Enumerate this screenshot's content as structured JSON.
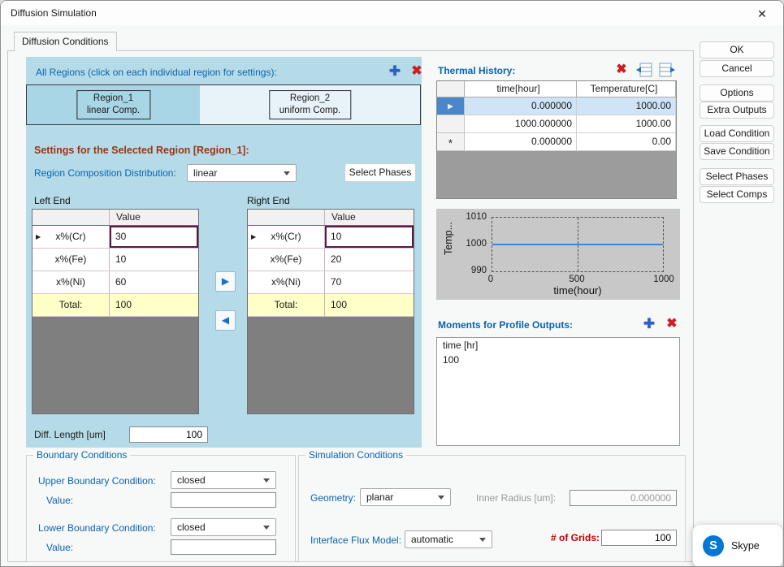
{
  "window": {
    "title": "Diffusion Simulation"
  },
  "tab": {
    "label": "Diffusion Conditions"
  },
  "icons": {
    "close": "✕",
    "plus": "✚",
    "delete": "✖",
    "row_arrow": "▶",
    "transfer_right": "▶",
    "transfer_left": "◀"
  },
  "regions": {
    "header": "All Regions (click on each individual region for settings):",
    "items": [
      {
        "name": "Region_1",
        "comp": "linear Comp."
      },
      {
        "name": "Region_2",
        "comp": "uniform Comp."
      }
    ]
  },
  "settings": {
    "title": "Settings for the Selected Region [Region_1]:",
    "dist_label": "Region Composition Distribution:",
    "dist_value": "linear",
    "select_phases_label": "Select Phases",
    "value_header": "Value",
    "total_label": "Total:",
    "left_end": {
      "label": "Left End",
      "rows": [
        {
          "label": "x%(Cr)",
          "value": "30"
        },
        {
          "label": "x%(Fe)",
          "value": "10"
        },
        {
          "label": "x%(Ni)",
          "value": "60"
        }
      ],
      "total": "100"
    },
    "right_end": {
      "label": "Right End",
      "rows": [
        {
          "label": "x%(Cr)",
          "value": "10"
        },
        {
          "label": "x%(Fe)",
          "value": "20"
        },
        {
          "label": "x%(Ni)",
          "value": "70"
        }
      ],
      "total": "100"
    },
    "diff_length_label": "Diff. Length [um]",
    "diff_length_value": "100"
  },
  "thermal": {
    "title": "Thermal History:",
    "columns": [
      "time[hour]",
      "Temperature[C]"
    ],
    "rows": [
      {
        "selector": "▶",
        "time": "0.000000",
        "temp": "1000.00"
      },
      {
        "selector": "",
        "time": "1000.000000",
        "temp": "1000.00"
      },
      {
        "selector": "*",
        "time": "0.000000",
        "temp": "0.00"
      }
    ]
  },
  "thermal_chart": {
    "type": "line",
    "ylabel": "Temp...",
    "xlabel": "time(hour)",
    "y_ticks": [
      "1010",
      "1000",
      "990"
    ],
    "x_ticks": [
      "0",
      "500",
      "1000"
    ],
    "ylim": [
      990,
      1010
    ],
    "xlim": [
      0,
      1000
    ],
    "series": [
      {
        "name": "Temperature",
        "x": [
          0,
          1000
        ],
        "y": [
          1000,
          1000
        ]
      }
    ],
    "line_color": "#3f84d6"
  },
  "moments": {
    "title": "Moments for Profile Outputs:",
    "items": [
      "time [hr]",
      "100"
    ]
  },
  "boundary": {
    "title": "Boundary Conditions",
    "upper_label": "Upper Boundary Condition:",
    "upper_value": "closed",
    "upper_value_label": "Value:",
    "upper_value_input": "",
    "lower_label": "Lower Boundary Condition:",
    "lower_value": "closed",
    "lower_value_label": "Value:",
    "lower_value_input": ""
  },
  "simulation": {
    "title": "Simulation Conditions",
    "geometry_label": "Geometry:",
    "geometry_value": "planar",
    "inner_radius_label": "Inner Radius [um]:",
    "inner_radius_value": "0.000000",
    "flux_label": "Interface Flux Model:",
    "flux_value": "automatic",
    "grids_label": "# of Grids:",
    "grids_value": "100"
  },
  "side_buttons": [
    "OK",
    "Cancel",
    "Options",
    "Extra Outputs",
    "Load Condition",
    "Save Condition",
    "Select Phases",
    "Select Comps"
  ],
  "skype": {
    "label": "Skype",
    "letter": "S",
    "brand_color": "#0078d4"
  }
}
